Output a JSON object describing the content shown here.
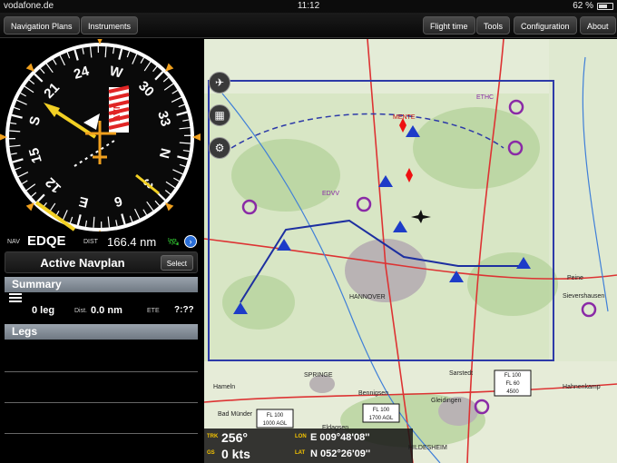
{
  "status_bar": {
    "carrier": "vodafone.de",
    "time": "11:12",
    "battery": "62 %",
    "battery_level": 0.62
  },
  "toolbar": {
    "left": [
      "Navigation Plans",
      "Instruments"
    ],
    "right": [
      "Flight time",
      "Tools",
      "Configuration",
      "About"
    ]
  },
  "compass": {
    "labels": [
      "N",
      "3",
      "6",
      "E",
      "12",
      "15",
      "S",
      "21",
      "24",
      "W",
      "30",
      "33"
    ],
    "nav_badge": "NAV"
  },
  "nav": {
    "nav_label": "NAV",
    "waypoint": "EDQE",
    "dist_label": "DIST",
    "distance": "166.4 nm"
  },
  "navplan": {
    "title": "Active Navplan",
    "select_label": "Select"
  },
  "summary": {
    "header": "Summary",
    "legs": "0 leg",
    "dist_label": "Dist.",
    "dist": "0.0 nm",
    "ete_label": "ETE",
    "ete": "?:??"
  },
  "legs": {
    "header": "Legs"
  },
  "map": {
    "labels": [
      "HANNOVER",
      "HILDESHEIM",
      "SPRINGE",
      "MENTE",
      "ETHC",
      "EDVV",
      "Bad Münder",
      "Bennigsen",
      "Sarstedt",
      "Eldagsen",
      "Gleidingen",
      "Sievershausen",
      "Peine",
      "Hameln",
      "Hahnenkamp"
    ],
    "frequency_boxes": [
      "FL 100",
      "FL 60",
      "4500",
      "FL 100",
      "1700 AGL",
      "FL 100",
      "1000 AGL"
    ]
  },
  "hud": {
    "trk_label": "TRK",
    "trk": "256°",
    "gs_label": "GS",
    "gs": "0 kts",
    "lon_label": "LON",
    "lon": "E 009°48'08''",
    "lat_label": "LAT",
    "lat": "N 052°26'09''"
  },
  "colors": {
    "accent": "#2a6ed8",
    "airspace": "#2d3aa8",
    "compass_needle": "#f0a01e",
    "bearing_pointer": "#f2d024"
  }
}
